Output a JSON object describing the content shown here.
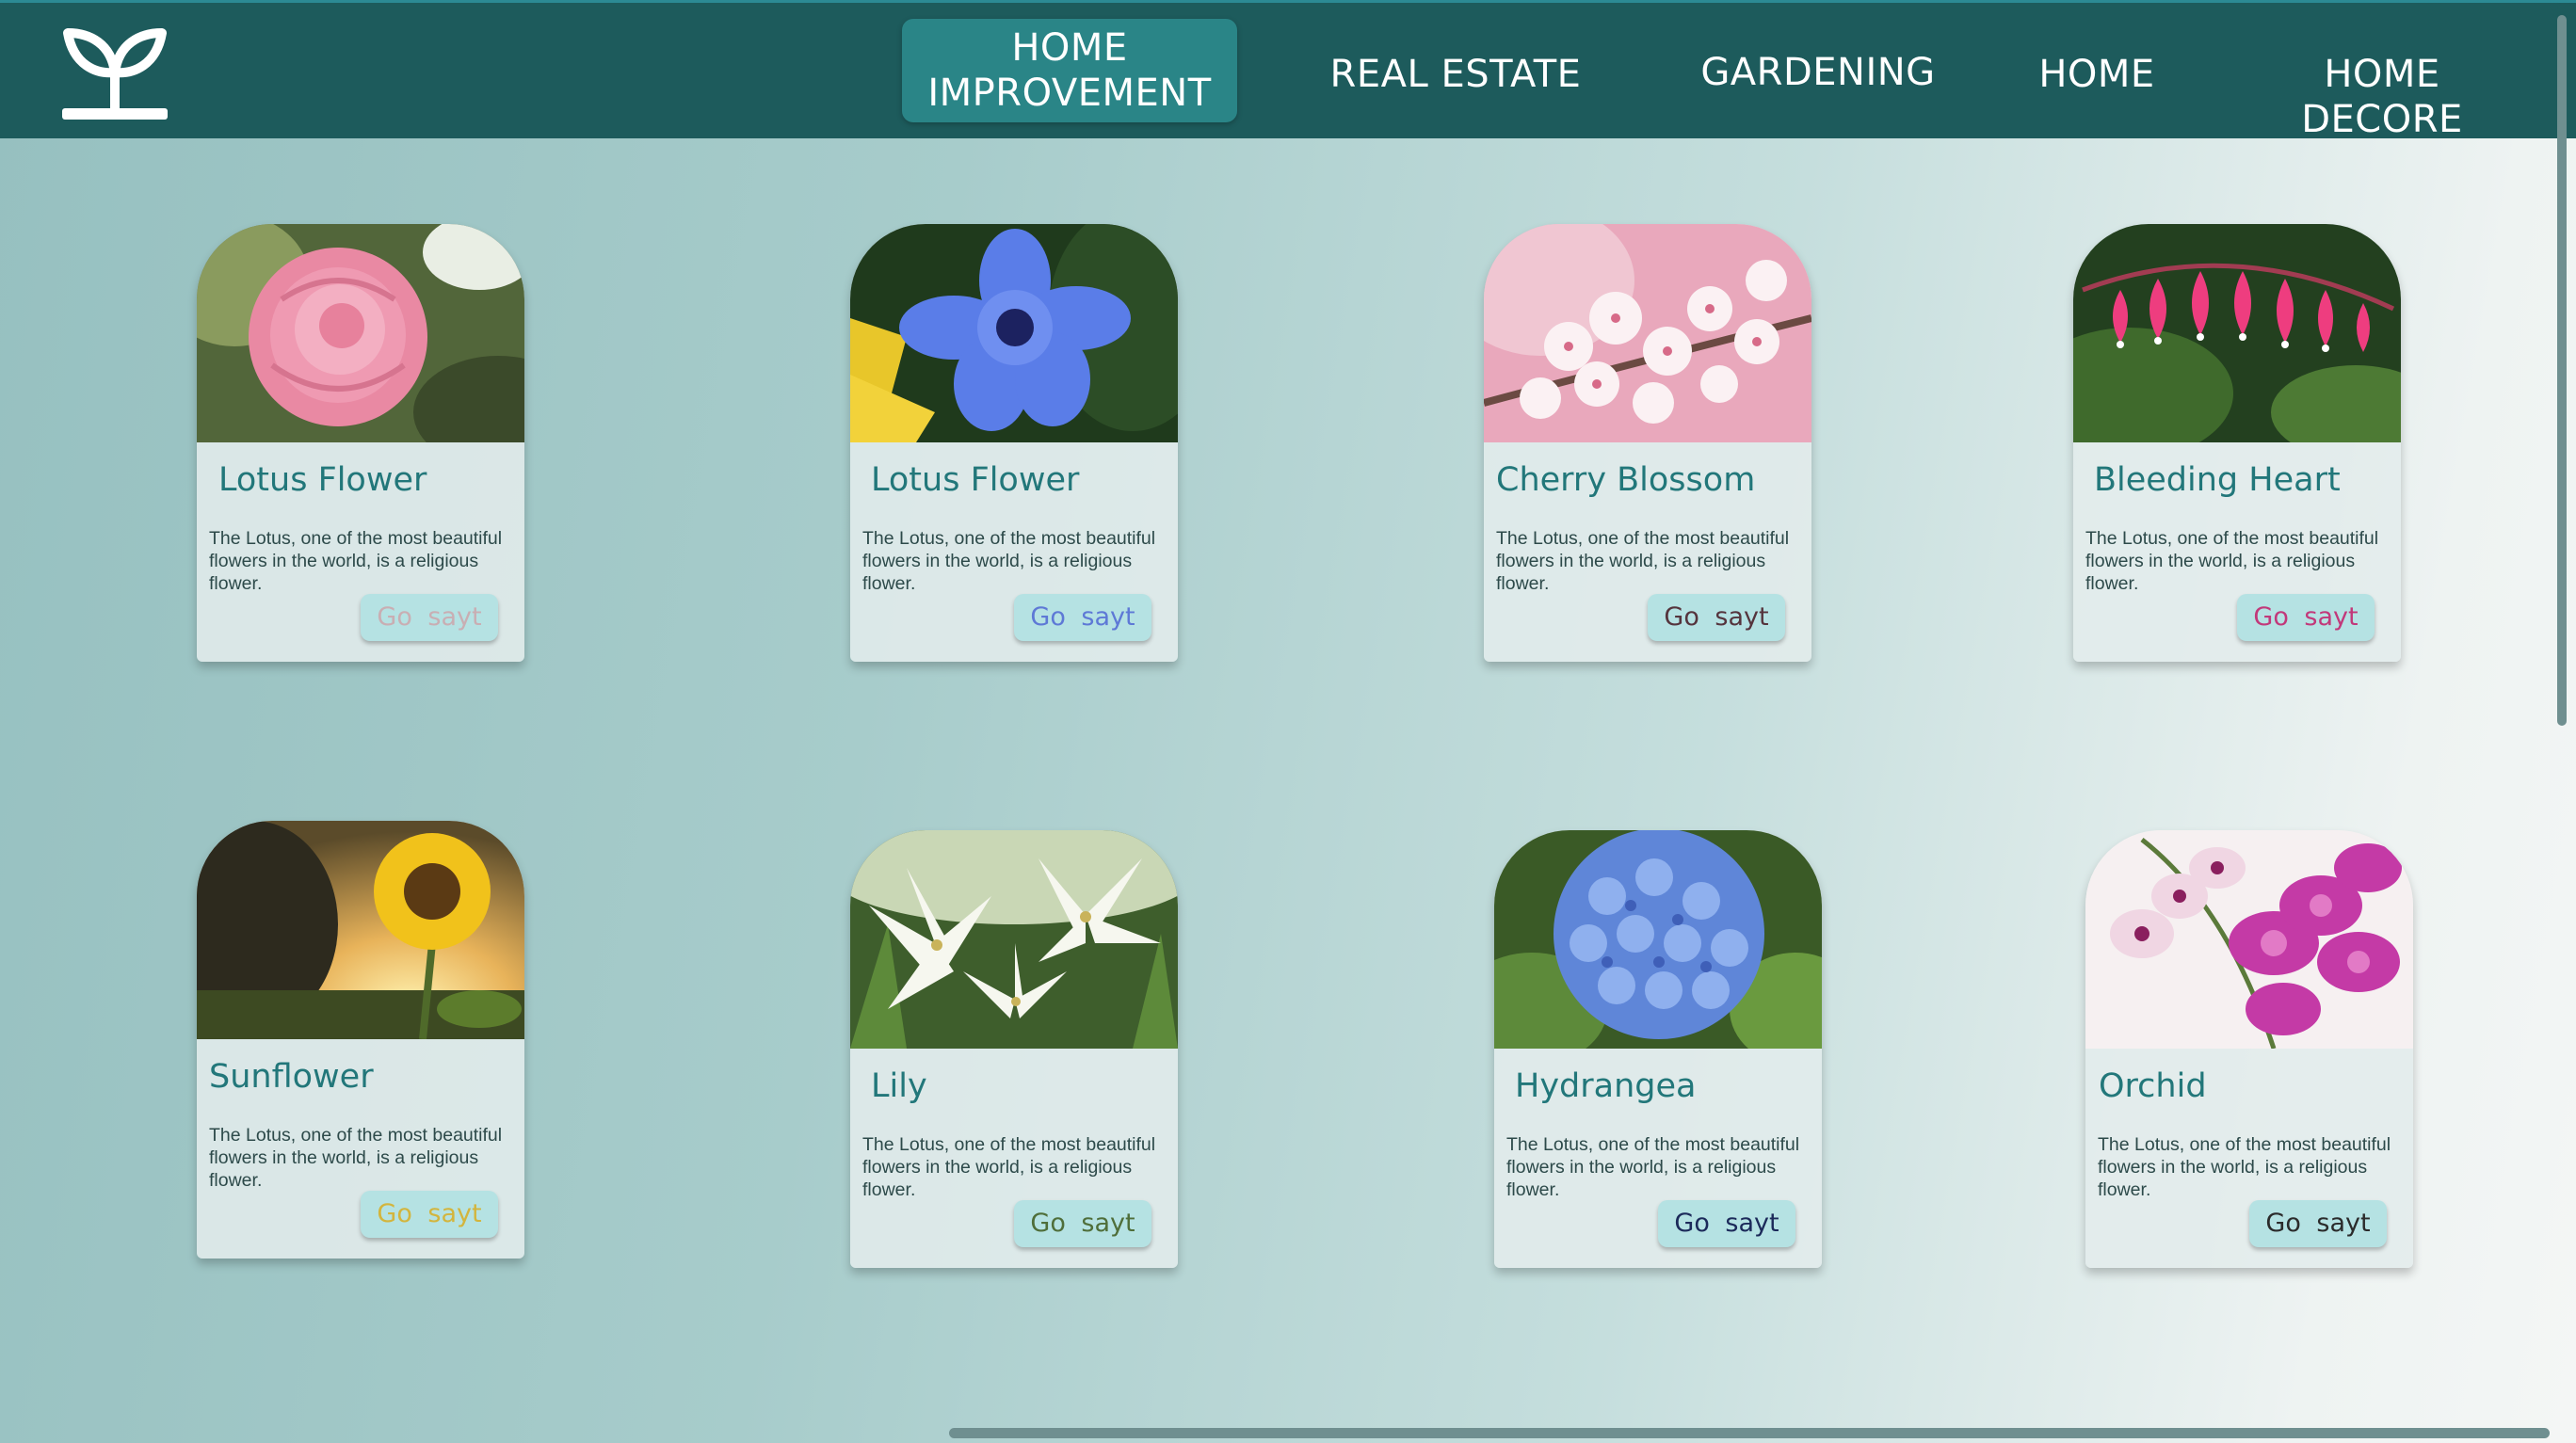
{
  "header": {
    "logo_icon": "sprout-icon",
    "nav": [
      {
        "label": "HOME\nIMPROVEMENT",
        "active": true
      },
      {
        "label": "REAL ESTATE"
      },
      {
        "label": "GARDENING"
      },
      {
        "label": "HOME"
      },
      {
        "label": "HOME DECORE"
      }
    ]
  },
  "cards": [
    {
      "title": "Lotus Flower",
      "description": "The Lotus, one of the most beautiful flowers in the world, is a religious flower.",
      "button": "Go sayt",
      "button_color": "#c9aeb3",
      "image": "pink-camellia"
    },
    {
      "title": "Lotus Flower",
      "description": "The Lotus, one of the most beautiful flowers in the world, is a religious flower.",
      "button": "Go sayt",
      "button_color": "#5e79d6",
      "image": "blue-anemone"
    },
    {
      "title": "Cherry Blossom",
      "description": "The Lotus, one of the most beautiful flowers in the world, is a religious flower.",
      "button": "Go sayt",
      "button_color": "#55343d",
      "image": "cherry-blossom"
    },
    {
      "title": "Bleeding Heart",
      "description": "The Lotus, one of the most beautiful flowers in the world, is a religious flower.",
      "button": "Go sayt",
      "button_color": "#c2387a",
      "image": "bleeding-heart"
    },
    {
      "title": "Sunflower",
      "description": "The Lotus, one of the most beautiful flowers in the world, is a religious flower.",
      "button": "Go sayt",
      "button_color": "#d3b53d",
      "image": "sunflower"
    },
    {
      "title": "Lily",
      "description": "The Lotus, one of the most beautiful flowers in the world, is a religious flower.",
      "button": "Go sayt",
      "button_color": "#4f6e3a",
      "image": "white-lily"
    },
    {
      "title": "Hydrangea",
      "description": "The Lotus, one of the most beautiful flowers in the world, is a religious flower.",
      "button": "Go sayt",
      "button_color": "#1c2a5a",
      "image": "blue-hydrangea"
    },
    {
      "title": "Orchid",
      "description": "The Lotus, one of the most beautiful flowers in the world, is a religious flower.",
      "button": "Go sayt",
      "button_color": "#2b2b2b",
      "image": "purple-orchid"
    }
  ]
}
